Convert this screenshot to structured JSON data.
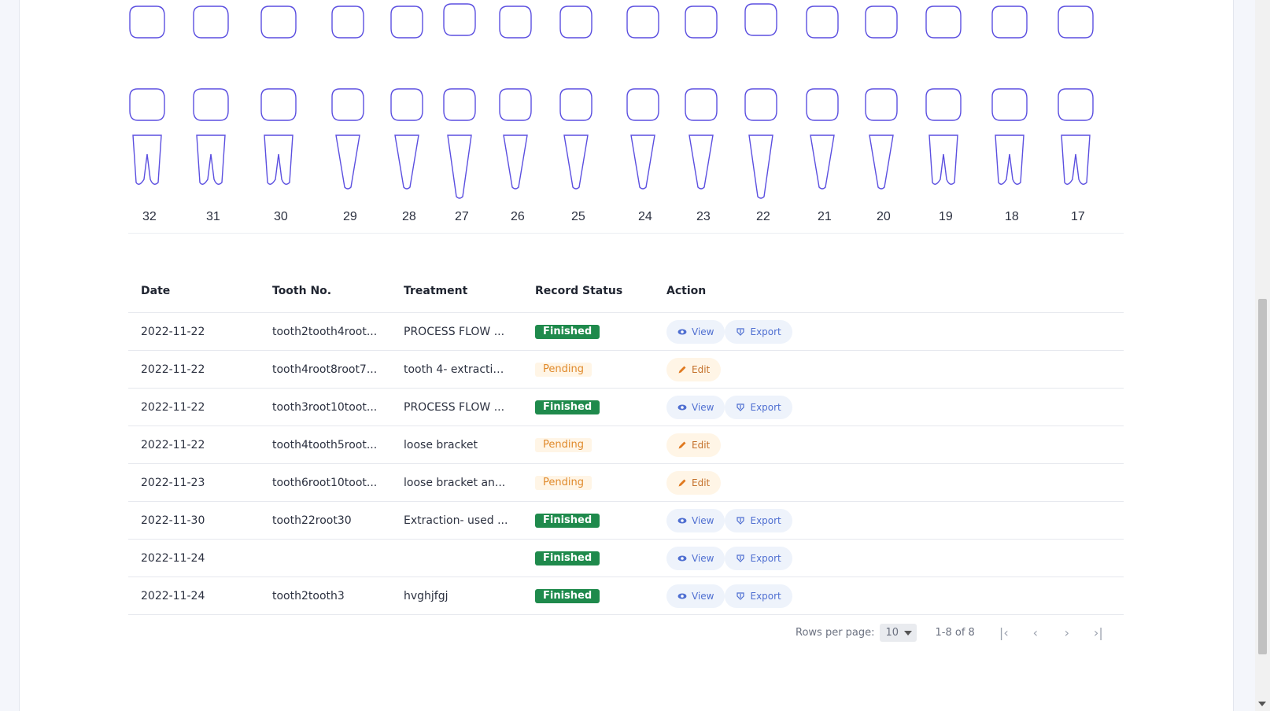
{
  "chart_labels": {
    "tooth_numbers": [
      "32",
      "31",
      "30",
      "29",
      "28",
      "27",
      "26",
      "25",
      "24",
      "23",
      "22",
      "21",
      "20",
      "19",
      "18",
      "17"
    ]
  },
  "table": {
    "headers": {
      "date": "Date",
      "tooth": "Tooth No.",
      "treatment": "Treatment",
      "status": "Record Status",
      "action": "Action"
    },
    "rows": [
      {
        "date": "2022-11-22",
        "tooth": "tooth2tooth4root...",
        "treatment": "PROCESS FLOW ...",
        "status": "Finished",
        "actions": [
          "View",
          "Export"
        ]
      },
      {
        "date": "2022-11-22",
        "tooth": "tooth4root8root7...",
        "treatment": "tooth 4- extractio...",
        "status": "Pending",
        "actions": [
          "Edit"
        ]
      },
      {
        "date": "2022-11-22",
        "tooth": "tooth3root10toot...",
        "treatment": "PROCESS FLOW ...",
        "status": "Finished",
        "actions": [
          "View",
          "Export"
        ]
      },
      {
        "date": "2022-11-22",
        "tooth": "tooth4tooth5root...",
        "treatment": "loose bracket",
        "status": "Pending",
        "actions": [
          "Edit"
        ]
      },
      {
        "date": "2022-11-23",
        "tooth": "tooth6root10toot...",
        "treatment": "loose bracket an...",
        "status": "Pending",
        "actions": [
          "Edit"
        ]
      },
      {
        "date": "2022-11-30",
        "tooth": "tooth22root30",
        "treatment": "Extraction- used ...",
        "status": "Finished",
        "actions": [
          "View",
          "Export"
        ]
      },
      {
        "date": "2022-11-24",
        "tooth": "",
        "treatment": "",
        "status": "Finished",
        "actions": [
          "View",
          "Export"
        ]
      },
      {
        "date": "2022-11-24",
        "tooth": "tooth2tooth3",
        "treatment": "hvghjfgj",
        "status": "Finished",
        "actions": [
          "View",
          "Export"
        ]
      }
    ]
  },
  "pagination": {
    "rows_per_page_label": "Rows per page:",
    "rows_per_page_value": "10",
    "range_text": "1-8 of 8"
  },
  "colors": {
    "tooth_outline": "#5b4fe0",
    "finished_badge": "#1f8a4c",
    "pending_text": "#e08a2c",
    "link_blue": "#4f6fd1"
  },
  "icons": {
    "view": "eye-icon",
    "export": "export-icon",
    "edit": "pencil-icon",
    "first_page": "first-page-icon",
    "prev_page": "chevron-left-icon",
    "next_page": "chevron-right-icon",
    "last_page": "last-page-icon"
  }
}
